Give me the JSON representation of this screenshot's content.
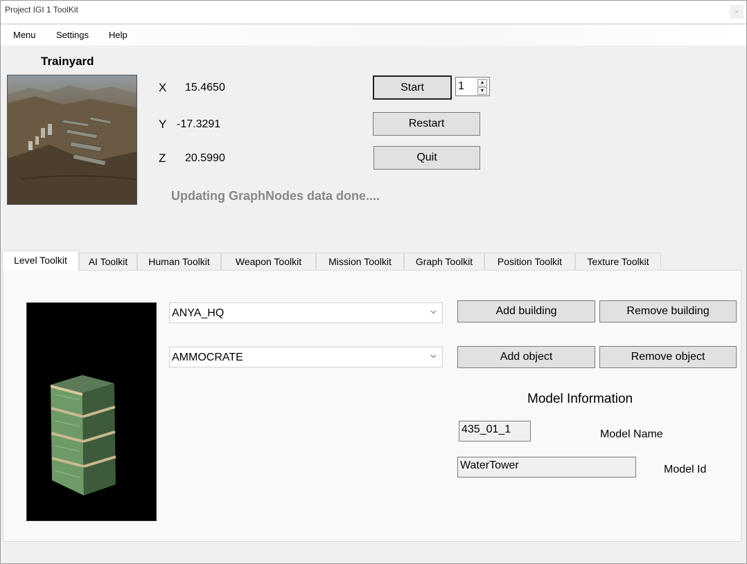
{
  "window": {
    "title": "Project IGI 1 ToolKit",
    "close_glyph": "×"
  },
  "menu": {
    "items": [
      "Menu",
      "Settings",
      "Help"
    ]
  },
  "level": {
    "name": "Trainyard",
    "image_icon": "level-terrain-thumbnail"
  },
  "coords": {
    "x_label": "X",
    "x_value": "15.4650",
    "y_label": "Y",
    "y_value": "-17.3291",
    "z_label": "Z",
    "z_value": "20.5990"
  },
  "actions": {
    "start": "Start",
    "restart": "Restart",
    "quit": "Quit"
  },
  "spinner": {
    "value": "1",
    "up_glyph": "▲",
    "down_glyph": "▼"
  },
  "status": "Updating GraphNodes data done....",
  "tabs": [
    "Level Toolkit",
    "AI Toolkit",
    "Human Toolkit",
    "Weapon Toolkit",
    "Mission Toolkit",
    "Graph Toolkit",
    "Position Toolkit",
    "Texture Toolkit"
  ],
  "active_tab": "Level Toolkit",
  "level_toolkit": {
    "building_select": "ANYA_HQ",
    "object_select": "AMMOCRATE",
    "add_building": "Add building",
    "remove_building": "Remove building",
    "add_object": "Add object",
    "remove_object": "Remove object",
    "model_info_title": "Model Information",
    "model_name_value": "435_01_1",
    "model_name_label": "Model Name",
    "model_id_value": "WaterTower",
    "model_id_label": "Model Id",
    "preview_icon": "ammo-crate-model-preview"
  },
  "colors": {
    "status_text": "#888888",
    "window_bg": "#f0f0f0",
    "preview_bg": "#000000"
  }
}
